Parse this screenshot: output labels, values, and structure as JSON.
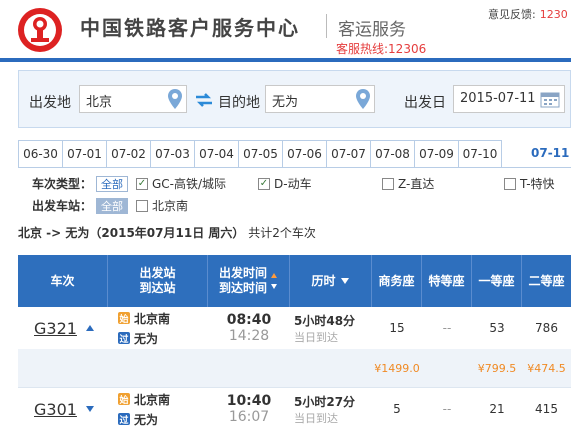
{
  "header": {
    "brand": "中国铁路客户服务中心",
    "subtitle": "客运服务",
    "hotline": "客服热线:12306",
    "feedback_label": "意见反馈:",
    "feedback_value": "1230"
  },
  "search": {
    "from_label": "出发地",
    "from_value": "北京",
    "to_label": "目的地",
    "to_value": "无为",
    "date_label": "出发日",
    "date_value": "2015-07-11"
  },
  "date_tabs": [
    "06-30",
    "07-01",
    "07-02",
    "07-03",
    "07-04",
    "07-05",
    "07-06",
    "07-07",
    "07-08",
    "07-09",
    "07-10"
  ],
  "active_tab": "07-11",
  "filters": {
    "type_label": "车次类型：",
    "all_label": "全部",
    "types": [
      {
        "label": "GC-高铁/城际",
        "checked": true
      },
      {
        "label": "D-动车",
        "checked": true
      },
      {
        "label": "Z-直达",
        "checked": false
      },
      {
        "label": "T-特快",
        "checked": false
      }
    ],
    "station_label": "出发车站：",
    "station_all": "全部",
    "stations": [
      {
        "label": "北京南",
        "checked": false
      }
    ]
  },
  "result": {
    "route": "北京 -> 无为（2015年07月11日  周六）",
    "count": "共计2个车次"
  },
  "table": {
    "headers": {
      "train": "车次",
      "station_line1": "出发站",
      "station_line2": "到达站",
      "time_line1": "出发时间",
      "time_line2": "到达时间",
      "duration": "历时",
      "business": "商务座",
      "premium": "特等座",
      "first": "一等座",
      "second": "二等座"
    },
    "rows": [
      {
        "train": "G321",
        "from_badge": "始",
        "from": "北京南",
        "to_badge": "过",
        "to": "无为",
        "depart": "08:40",
        "arrive": "14:28",
        "duration": "5小时48分",
        "arrive_day": "当日到达",
        "business": "15",
        "premium": "--",
        "first": "53",
        "second": "786",
        "price_business": "¥1499.0",
        "price_first": "¥799.5",
        "price_second": "¥474.5"
      },
      {
        "train": "G301",
        "from_badge": "始",
        "from": "北京南",
        "to_badge": "过",
        "to": "无为",
        "depart": "10:40",
        "arrive": "16:07",
        "duration": "5小时27分",
        "arrive_day": "当日到达",
        "business": "5",
        "premium": "--",
        "first": "21",
        "second": "415"
      }
    ]
  }
}
